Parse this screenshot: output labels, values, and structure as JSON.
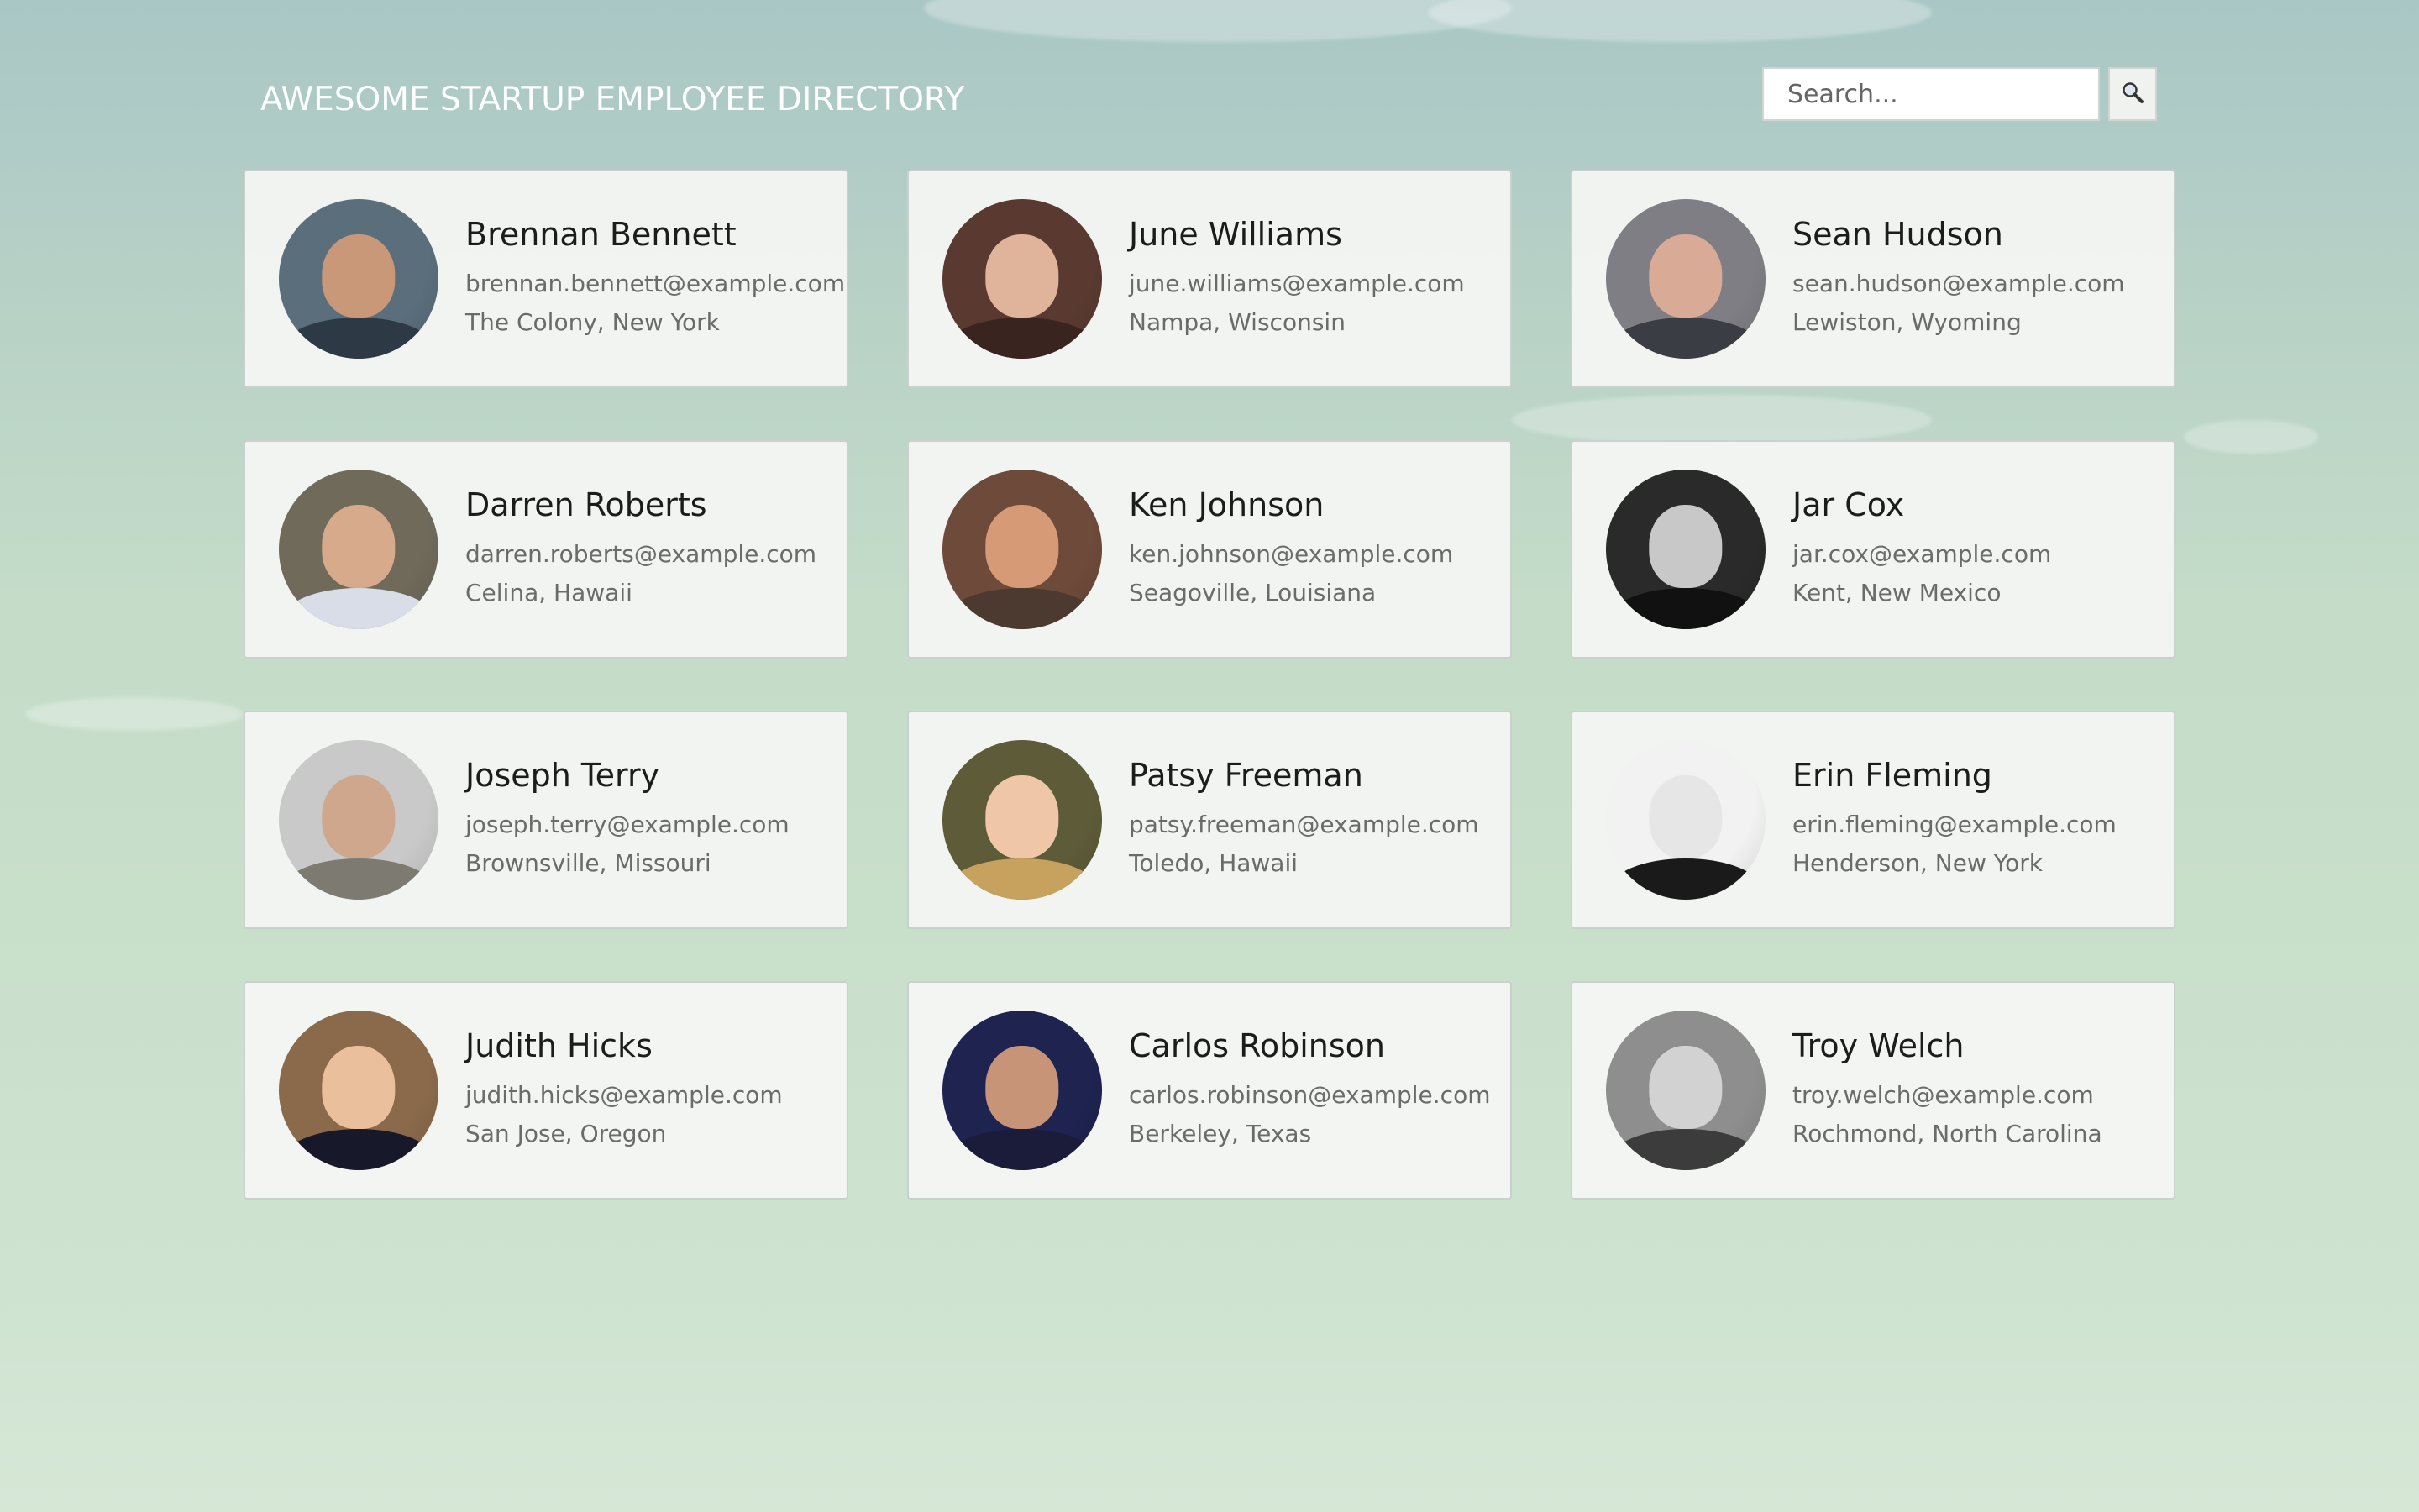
{
  "header": {
    "title": "AWESOME STARTUP EMPLOYEE DIRECTORY"
  },
  "search": {
    "placeholder": "Search...",
    "button_icon": "search-icon"
  },
  "employees": [
    {
      "name": "Brennan Bennett",
      "email": "brennan.bennett@example.com",
      "location": "The Colony, New York",
      "avatar_bg": "#5a6e7c",
      "skin": "#c99878",
      "clothing": "#2d3a45"
    },
    {
      "name": "June Williams",
      "email": "june.williams@example.com",
      "location": "Nampa, Wisconsin",
      "avatar_bg": "#5a3a30",
      "skin": "#e0b49a",
      "clothing": "#3a2420"
    },
    {
      "name": "Sean Hudson",
      "email": "sean.hudson@example.com",
      "location": "Lewiston, Wyoming",
      "avatar_bg": "#7e7e84",
      "skin": "#d9ab97",
      "clothing": "#3b3d44"
    },
    {
      "name": "Darren Roberts",
      "email": "darren.roberts@example.com",
      "location": "Celina, Hawaii",
      "avatar_bg": "#6f6a5a",
      "skin": "#d7aa8c",
      "clothing": "#d9dde8"
    },
    {
      "name": "Ken Johnson",
      "email": "ken.johnson@example.com",
      "location": "Seagoville, Louisiana",
      "avatar_bg": "#6e4a3a",
      "skin": "#d69a76",
      "clothing": "#4c3a30"
    },
    {
      "name": "Jar Cox",
      "email": "jar.cox@example.com",
      "location": "Kent, New Mexico",
      "avatar_bg": "#2a2a2a",
      "skin": "#c8c8c8",
      "clothing": "#111111"
    },
    {
      "name": "Joseph Terry",
      "email": "joseph.terry@example.com",
      "location": "Brownsville, Missouri",
      "avatar_bg": "#c9c9c9",
      "skin": "#cfa78c",
      "clothing": "#7d7a72"
    },
    {
      "name": "Patsy Freeman",
      "email": "patsy.freeman@example.com",
      "location": "Toledo, Hawaii",
      "avatar_bg": "#5d5b38",
      "skin": "#f0c6a8",
      "clothing": "#c7a25e"
    },
    {
      "name": "Erin Fleming",
      "email": "erin.fleming@example.com",
      "location": "Henderson, New York",
      "avatar_bg": "#f2f2f2",
      "skin": "#e6e6e6",
      "clothing": "#1a1a1a"
    },
    {
      "name": "Judith Hicks",
      "email": "judith.hicks@example.com",
      "location": "San Jose, Oregon",
      "avatar_bg": "#8a6a4a",
      "skin": "#e9bf9c",
      "clothing": "#17182a"
    },
    {
      "name": "Carlos Robinson",
      "email": "carlos.robinson@example.com",
      "location": "Berkeley, Texas",
      "avatar_bg": "#1e2350",
      "skin": "#c89478",
      "clothing": "#1b1b3a"
    },
    {
      "name": "Troy Welch",
      "email": "troy.welch@example.com",
      "location": "Rochmond, North Carolina",
      "avatar_bg": "#8e8e8e",
      "skin": "#d2d2d2",
      "clothing": "#3c3c3c"
    }
  ]
}
